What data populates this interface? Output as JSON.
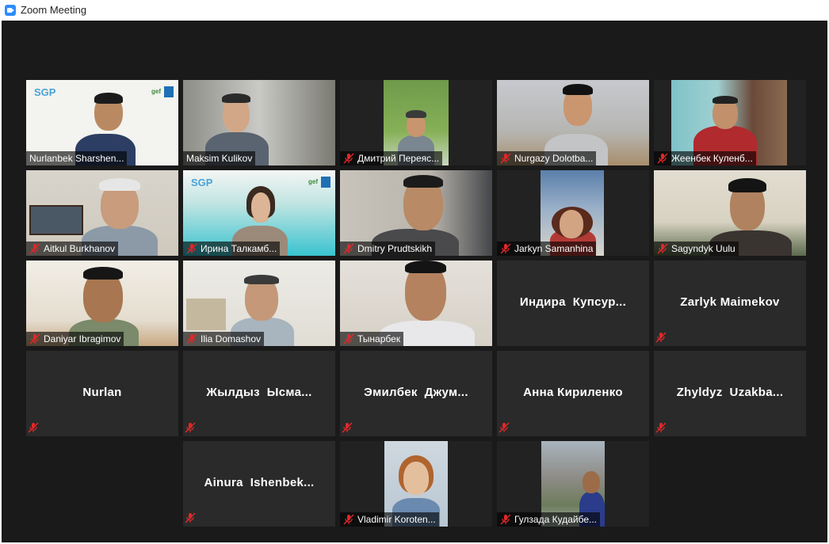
{
  "window": {
    "title": "Zoom Meeting",
    "icon": "zoom-logo-icon"
  },
  "tiles": [
    {
      "name": "Nurlanbek Sharshen...",
      "muted": false,
      "video": true,
      "active": false
    },
    {
      "name": "Maksim Kulikov",
      "muted": false,
      "video": true,
      "active": true
    },
    {
      "name": "Дмитрий Переяс...",
      "muted": true,
      "video": true,
      "active": false
    },
    {
      "name": "Nurgazy Dolotba...",
      "muted": true,
      "video": true,
      "active": false
    },
    {
      "name": "Жеенбек Куленб...",
      "muted": true,
      "video": true,
      "active": false
    },
    {
      "name": "Aitkul Burkhanov",
      "muted": true,
      "video": true,
      "active": false
    },
    {
      "name": "Ирина Талкамб...",
      "muted": true,
      "video": true,
      "active": false
    },
    {
      "name": "Dmitry Prudtskikh",
      "muted": true,
      "video": true,
      "active": false
    },
    {
      "name": "Jarkyn Samanhina",
      "muted": true,
      "video": true,
      "active": false
    },
    {
      "name": "Sagyndyk Uulu",
      "muted": true,
      "video": true,
      "active": false
    },
    {
      "name": "Daniyar Ibragimov",
      "muted": true,
      "video": true,
      "active": false
    },
    {
      "name": "Ilia Domashov",
      "muted": true,
      "video": true,
      "active": false
    },
    {
      "name": "Тынарбек",
      "muted": true,
      "video": true,
      "active": false
    },
    {
      "name": "Индира  Купсур...",
      "muted": false,
      "video": false,
      "active": false
    },
    {
      "name": "Zarlyk Maimekov",
      "muted": true,
      "video": false,
      "active": false
    },
    {
      "name": "Nurlan",
      "muted": true,
      "video": false,
      "active": false
    },
    {
      "name": "Жылдыз  Ысма...",
      "muted": true,
      "video": false,
      "active": false
    },
    {
      "name": "Эмилбек  Джум...",
      "muted": true,
      "video": false,
      "active": false
    },
    {
      "name": "Анна Кириленко",
      "muted": true,
      "video": false,
      "active": false
    },
    {
      "name": "Zhyldyz  Uzakba...",
      "muted": true,
      "video": false,
      "active": false
    },
    {
      "name": "Ainura  Ishenbek...",
      "muted": true,
      "video": false,
      "active": false
    },
    {
      "name": "Vladimir Koroten...",
      "muted": true,
      "video": true,
      "active": false
    },
    {
      "name": "Гулзада Кудайбе...",
      "muted": true,
      "video": true,
      "active": false
    }
  ],
  "branding": {
    "sgp_logo": "SGP",
    "gef_logo": "gef"
  },
  "colors": {
    "stage_bg": "#1a1a1a",
    "tile_bg": "#2a2a2a",
    "active_border": "#cbe35a",
    "mute_red": "#e02828"
  }
}
